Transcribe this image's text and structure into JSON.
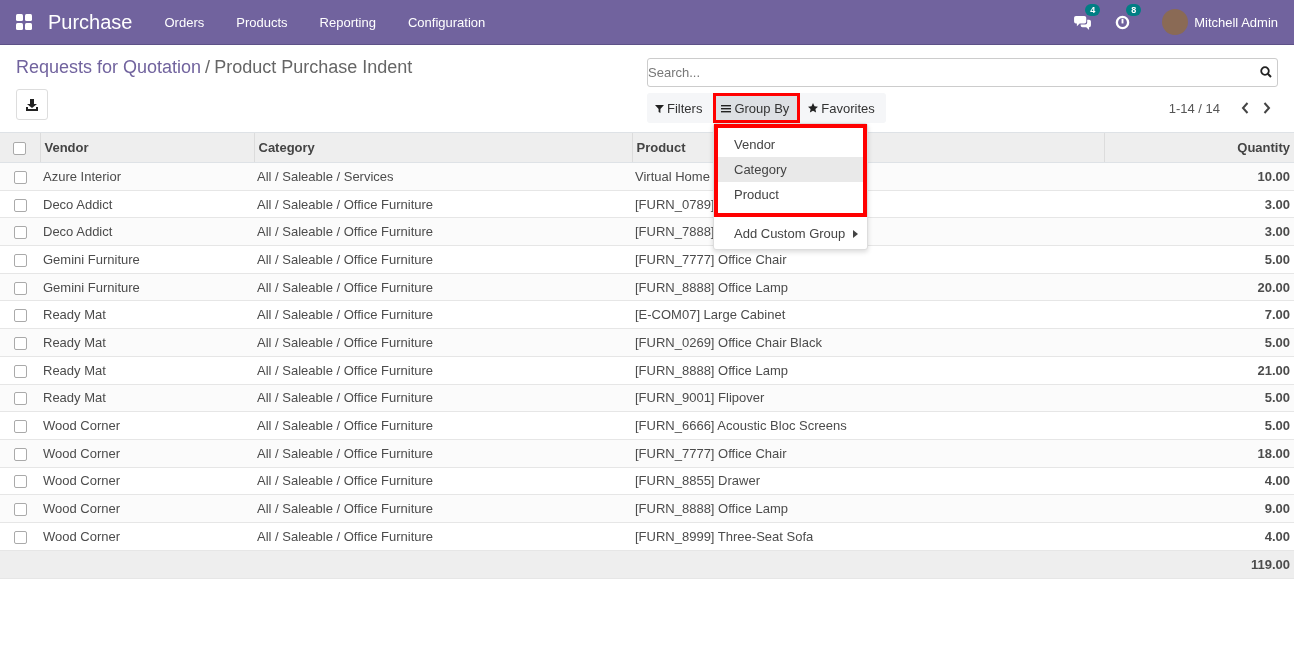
{
  "navbar": {
    "app_name": "Purchase",
    "menu": [
      "Orders",
      "Products",
      "Reporting",
      "Configuration"
    ],
    "messages_badge": "4",
    "activities_badge": "8",
    "user": "Mitchell Admin"
  },
  "breadcrumb": {
    "parent": "Requests for Quotation",
    "separator": "/",
    "current": "Product Purchase Indent"
  },
  "search": {
    "placeholder": "Search..."
  },
  "search_buttons": [
    {
      "label": "Filters",
      "kind": "filter",
      "selected": false
    },
    {
      "label": "Group By",
      "kind": "groupby",
      "selected": true
    },
    {
      "label": "Favorites",
      "kind": "star",
      "selected": false
    }
  ],
  "pager": "1-14 / 14",
  "group_by_menu": {
    "options": [
      {
        "label": "Vendor",
        "selected": false
      },
      {
        "label": "Category",
        "selected": true
      },
      {
        "label": "Product",
        "selected": false
      }
    ],
    "custom": "Add Custom Group"
  },
  "table": {
    "select_all_checked": false,
    "columns": [
      "Vendor",
      "Category",
      "Product",
      "Quantity"
    ],
    "rows": [
      {
        "checked": false,
        "vendor": "Azure Interior",
        "category": "All / Saleable / Services",
        "product": "Virtual Home",
        "quantity": "10.00"
      },
      {
        "checked": false,
        "vendor": "Deco Addict",
        "category": "All / Saleable / Office Furniture",
        "product": "[FURN_0789]",
        "quantity": "3.00"
      },
      {
        "checked": false,
        "vendor": "Deco Addict",
        "category": "All / Saleable / Office Furniture",
        "product": "[FURN_7888]",
        "quantity": "3.00"
      },
      {
        "checked": false,
        "vendor": "Gemini Furniture",
        "category": "All / Saleable / Office Furniture",
        "product": "[FURN_7777] Office Chair",
        "quantity": "5.00"
      },
      {
        "checked": false,
        "vendor": "Gemini Furniture",
        "category": "All / Saleable / Office Furniture",
        "product": "[FURN_8888] Office Lamp",
        "quantity": "20.00"
      },
      {
        "checked": false,
        "vendor": "Ready Mat",
        "category": "All / Saleable / Office Furniture",
        "product": "[E-COM07] Large Cabinet",
        "quantity": "7.00"
      },
      {
        "checked": false,
        "vendor": "Ready Mat",
        "category": "All / Saleable / Office Furniture",
        "product": "[FURN_0269] Office Chair Black",
        "quantity": "5.00"
      },
      {
        "checked": false,
        "vendor": "Ready Mat",
        "category": "All / Saleable / Office Furniture",
        "product": "[FURN_8888] Office Lamp",
        "quantity": "21.00"
      },
      {
        "checked": false,
        "vendor": "Ready Mat",
        "category": "All / Saleable / Office Furniture",
        "product": "[FURN_9001] Flipover",
        "quantity": "5.00"
      },
      {
        "checked": false,
        "vendor": "Wood Corner",
        "category": "All / Saleable / Office Furniture",
        "product": "[FURN_6666] Acoustic Bloc Screens",
        "quantity": "5.00"
      },
      {
        "checked": false,
        "vendor": "Wood Corner",
        "category": "All / Saleable / Office Furniture",
        "product": "[FURN_7777] Office Chair",
        "quantity": "18.00"
      },
      {
        "checked": false,
        "vendor": "Wood Corner",
        "category": "All / Saleable / Office Furniture",
        "product": "[FURN_8855] Drawer",
        "quantity": "4.00"
      },
      {
        "checked": false,
        "vendor": "Wood Corner",
        "category": "All / Saleable / Office Furniture",
        "product": "[FURN_8888] Office Lamp",
        "quantity": "9.00"
      },
      {
        "checked": false,
        "vendor": "Wood Corner",
        "category": "All / Saleable / Office Furniture",
        "product": "[FURN_8999] Three-Seat Sofa",
        "quantity": "4.00"
      }
    ],
    "total": "119.00"
  }
}
